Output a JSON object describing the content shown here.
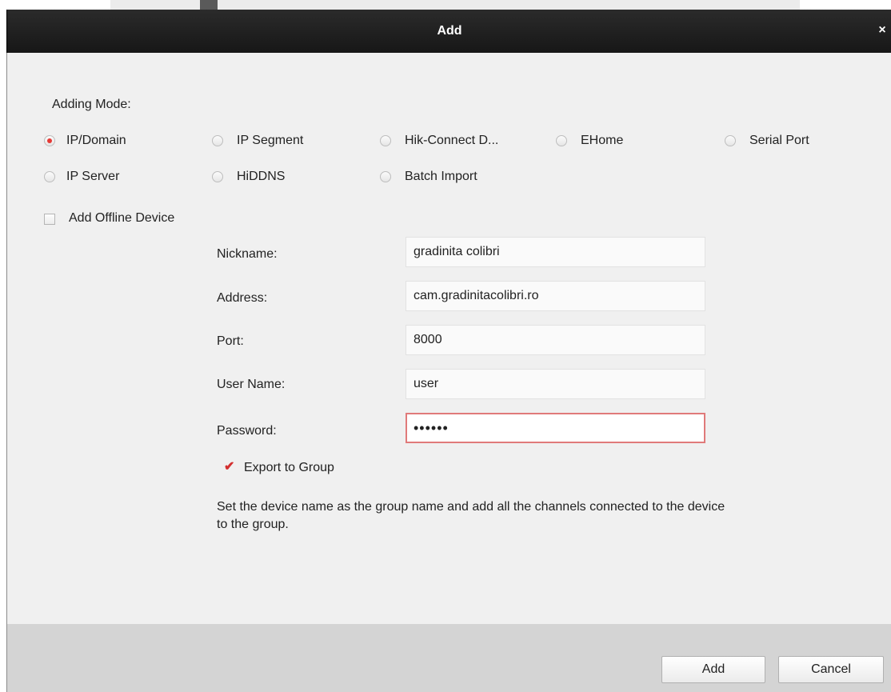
{
  "dialog": {
    "title": "Add"
  },
  "adding_mode": {
    "label": "Adding Mode:",
    "options": [
      {
        "label": "IP/Domain",
        "selected": true
      },
      {
        "label": "IP Segment",
        "selected": false
      },
      {
        "label": "Hik-Connect D...",
        "selected": false
      },
      {
        "label": "EHome",
        "selected": false
      },
      {
        "label": "Serial Port",
        "selected": false
      },
      {
        "label": "IP Server",
        "selected": false
      },
      {
        "label": "HiDDNS",
        "selected": false
      },
      {
        "label": "Batch Import",
        "selected": false
      }
    ]
  },
  "offline": {
    "label": "Add Offline Device",
    "checked": false
  },
  "form": {
    "nickname": {
      "label": "Nickname:",
      "value": "gradinita colibri"
    },
    "address": {
      "label": "Address:",
      "value": "cam.gradinitacolibri.ro"
    },
    "port": {
      "label": "Port:",
      "value": "8000"
    },
    "username": {
      "label": "User Name:",
      "value": "user"
    },
    "password": {
      "label": "Password:",
      "value": "••••••"
    }
  },
  "export_group": {
    "label": "Export to Group",
    "checked": true,
    "note": "Set the device name as the group name and add all the channels connected to the device to the group."
  },
  "buttons": {
    "add": "Add",
    "cancel": "Cancel"
  },
  "colors": {
    "accent": "#e53935",
    "titlebar": "#1f1f1f"
  },
  "icons": {
    "close": "close-icon",
    "check": "check-icon"
  }
}
